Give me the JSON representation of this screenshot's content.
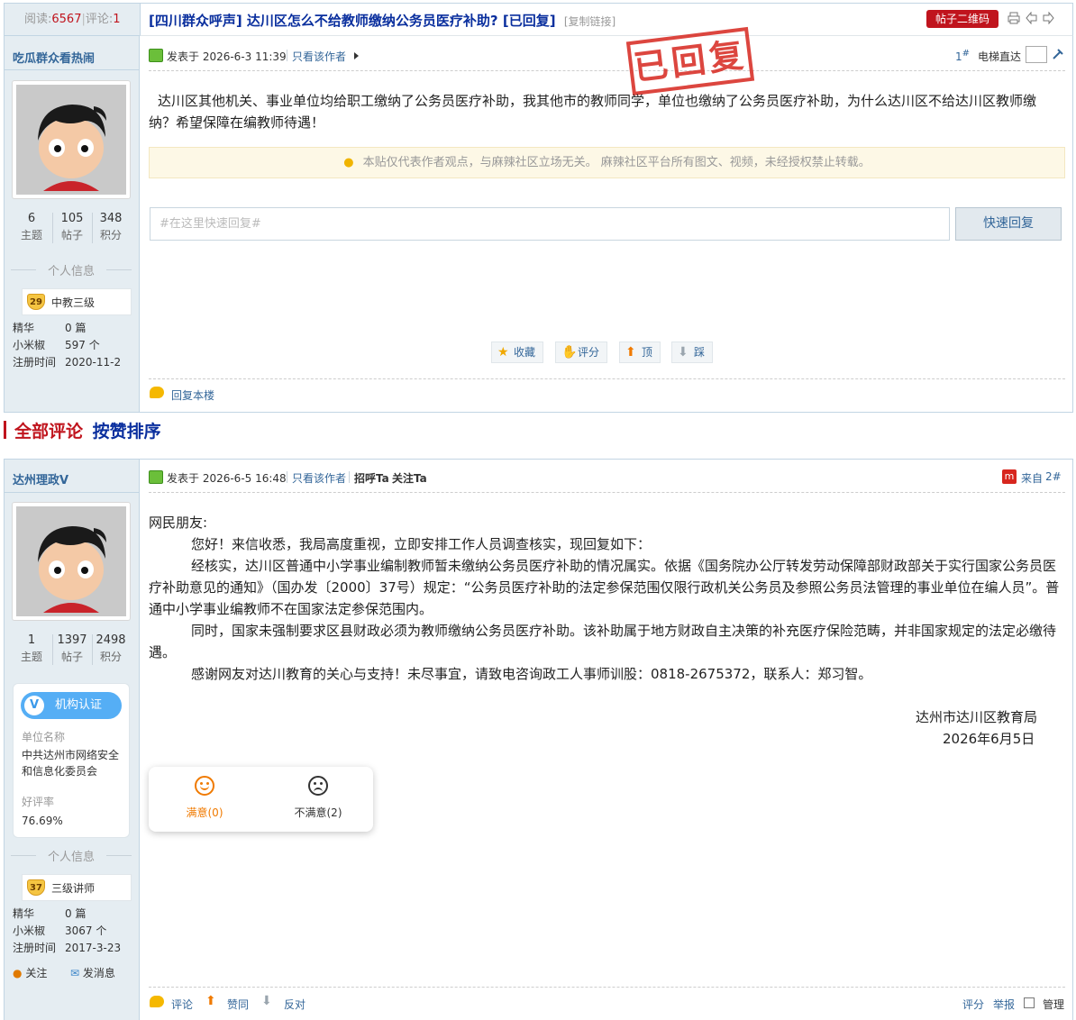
{
  "header": {
    "reads_label": "阅读:",
    "reads_count": "6567",
    "comments_label": "评论:",
    "comments_count": "1",
    "title": "[四川群众呼声] 达川区怎么不给教师缴纳公务员医疗补助? [已回复]",
    "copy_link": "[复制链接]",
    "qr_button": "帖子二维码"
  },
  "stamp": {
    "text": "已回复"
  },
  "post1": {
    "author": "吃瓜群众看热闹",
    "stats": [
      {
        "value": "6",
        "label": "主题"
      },
      {
        "value": "105",
        "label": "帖子"
      },
      {
        "value": "348",
        "label": "积分"
      }
    ],
    "personal_info": "个人信息",
    "level_num": "29",
    "level_name": "中教三级",
    "meta": [
      {
        "label": "精华",
        "value": "0 篇"
      },
      {
        "label": "小米椒",
        "value": "597 个"
      },
      {
        "label": "注册时间",
        "value": "2020-11-2"
      }
    ],
    "posted_at": "发表于 2026-6-3 11:39",
    "only_author": "只看该作者",
    "floor": "1",
    "elevator": "电梯直达",
    "content": "达川区其他机关、事业单位均给职工缴纳了公务员医疗补助，我其他市的教师同学，单位也缴纳了公务员医疗补助，为什么达川区不给达川区教师缴纳？希望保障在编教师待遇！",
    "notice": "本贴仅代表作者观点，与麻辣社区立场无关。  麻辣社区平台所有图文、视频，未经授权禁止转载。",
    "reply_placeholder": "#在这里快速回复#",
    "reply_button": "快速回复",
    "actions": [
      "收藏",
      "评分",
      "顶",
      "踩"
    ],
    "reply_floor": "回复本楼"
  },
  "section": {
    "title1": "全部评论",
    "title2": "按赞排序"
  },
  "post2": {
    "author": "达州理政V",
    "stats": [
      {
        "value": "1",
        "label": "主题"
      },
      {
        "value": "1397",
        "label": "帖子"
      },
      {
        "value": "2498",
        "label": "积分"
      }
    ],
    "org_badge": "机构认证",
    "org_label": "单位名称",
    "org_name": "中共达州市网络安全和信息化委员会",
    "rating_label": "好评率",
    "rating_value": "76.69%",
    "personal_info": "个人信息",
    "level_num": "37",
    "level_name": "三级讲师",
    "meta": [
      {
        "label": "精华",
        "value": "0 篇"
      },
      {
        "label": "小米椒",
        "value": "3067 个"
      },
      {
        "label": "注册时间",
        "value": "2017-3-23"
      }
    ],
    "follow": "关注",
    "message": "发消息",
    "posted_at": "发表于 2026-6-5 16:48",
    "only_author": "只看该作者",
    "greet": "招呼Ta",
    "follow_ta": "关注Ta",
    "from_label": "来自",
    "floor": "2",
    "greeting": "网民朋友:",
    "p1": "您好！来信收悉，我局高度重视，立即安排工作人员调查核实，现回复如下：",
    "p2": "经核实，达川区普通中小学事业编制教师暂未缴纳公务员医疗补助的情况属实。依据《国务院办公厅转发劳动保障部财政部关于实行国家公务员医疗补助意见的通知》（国办发〔2000〕37号）规定：“公务员医疗补助的法定参保范围仅限行政机关公务员及参照公务员法管理的事业单位在编人员”。普通中小学事业编教师不在国家法定参保范围内。",
    "p3": "同时，国家未强制要求区县财政必须为教师缴纳公务员医疗补助。该补助属于地方财政自主决策的补充医疗保险范畴，并非国家规定的法定必缴待遇。",
    "p4": "感谢网友对达川教育的关心与支持！未尽事宜，请致电咨询政工人事师训股：0818-2675372，联系人：郑习智。",
    "sign_org": "达州市达川区教育局",
    "sign_date": "2026年6月5日",
    "satisfied": "满意(0)",
    "unsatisfied": "不满意(2)",
    "footer": {
      "comment": "评论",
      "agree": "赞同",
      "oppose": "反对",
      "rate": "评分",
      "report": "举报",
      "manage": "管理"
    }
  },
  "colors": {
    "accent_blue": "#336699",
    "title_blue": "#0a2f9e",
    "red": "#c0141d",
    "sidebar_bg": "#e5edf2",
    "stamp_red": "#d7261e"
  }
}
